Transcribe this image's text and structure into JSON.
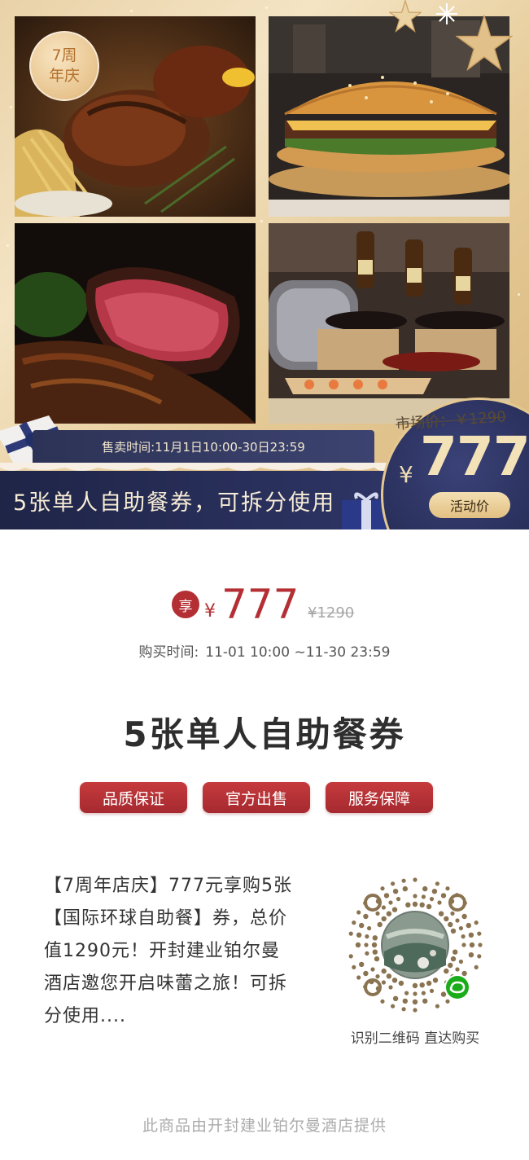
{
  "hero": {
    "anniversary_badge": [
      "7周",
      "年庆"
    ],
    "sale_time": "售卖时间:11月1日10:00-30日23:59",
    "title": "5张单人自助餐券，可拆分使用",
    "market_price": "市场价：￥1290",
    "price_symbol": "¥",
    "price": "777",
    "price_tag": "活动价",
    "photos": [
      "grilled-meat-photo",
      "burger-photo",
      "steak-photo",
      "buffet-sushi-photo"
    ]
  },
  "price_section": {
    "badge": "享",
    "currency": "¥",
    "price": "777",
    "original_price": "¥1290",
    "buy_time_label": "购买时间:",
    "buy_time_value": "11-01 10:00 ~11-30 23:59"
  },
  "product_title": "5张单人自助餐券",
  "tags": [
    "品质保证",
    "官方出售",
    "服务保障"
  ],
  "description": "【7周年店庆】777元享购5张【国际环球自助餐】券，总价值1290元！开封建业铂尔曼酒店邀您开启味蕾之旅！可拆分使用....",
  "qr": {
    "caption": "识别二维码 直达购买",
    "icon": "wechat-mini-program-icon"
  },
  "footer": "此商品由开封建业铂尔曼酒店提供",
  "colors": {
    "accent_red": "#b42f34",
    "navy": "#262c55",
    "gold": "#e5c890"
  }
}
